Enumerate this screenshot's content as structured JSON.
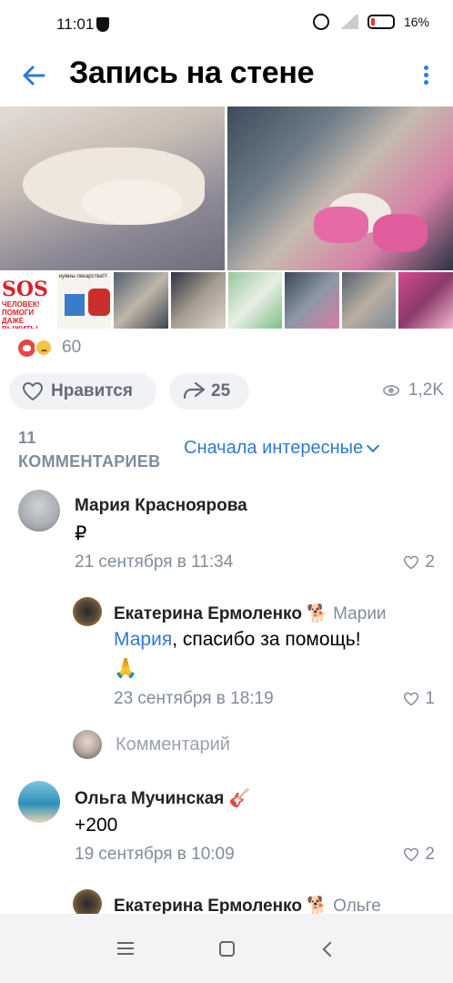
{
  "status_bar": {
    "time": "11:01",
    "battery": "16%"
  },
  "header": {
    "title": "Запись на стене"
  },
  "photos": {
    "thumb_sos_title": "SOS",
    "thumb_sos_sub": "ЧЕЛОВЕК! ПОМОГИ ДАЖЕ ВЫЖИТЬ!",
    "thumb_note": "нужны лекарства!!!"
  },
  "reactions": {
    "count": "60"
  },
  "actions": {
    "like_label": "Нравится",
    "share_count": "25",
    "views": "1,2K"
  },
  "comments_header": {
    "count_label": "11 КОММЕНТАРИЕВ",
    "sort_label": "Сначала интересные"
  },
  "comments": [
    {
      "author": "Мария Красноярова",
      "text": "₽",
      "date": "21 сентября в 11:34",
      "likes": "2"
    },
    {
      "author": "Екатерина Ермоленко 🐕",
      "reply_to": "Марии",
      "mention": "Мария",
      "text": ", спасибо за помощь!",
      "text2": "🙏",
      "date": "23 сентября в 18:19",
      "likes": "1"
    },
    {
      "author": "Ольга Мучинская 🎸",
      "text": "+200",
      "date": "19 сентября в 10:09",
      "likes": "2"
    },
    {
      "author": "Екатерина Ермоленко 🐕",
      "reply_to": "Ольге"
    }
  ],
  "reply_field": {
    "placeholder": "Комментарий"
  },
  "icons": {
    "back": "arrow-left-icon",
    "more": "more-vertical-icon",
    "like": "heart-outline-icon",
    "share": "share-icon",
    "views": "eye-icon",
    "sort": "chevron-down-icon"
  },
  "colors": {
    "accent": "#2f79d6",
    "secondary_text": "#818c99",
    "button_bg": "#f0f2f5"
  }
}
